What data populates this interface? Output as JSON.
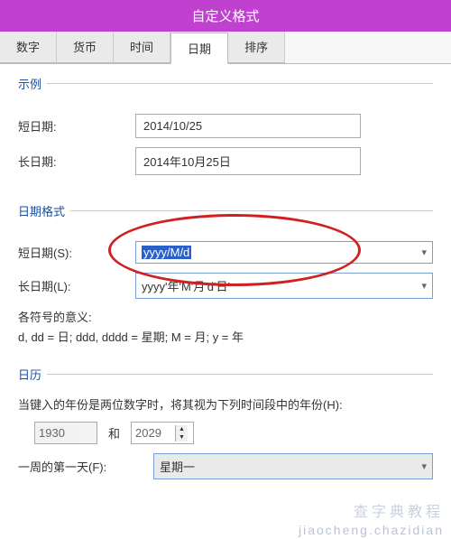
{
  "title": "自定义格式",
  "tabs": {
    "number": "数字",
    "currency": "货币",
    "time": "时间",
    "date": "日期",
    "sort": "排序"
  },
  "example": {
    "legend": "示例",
    "short_label": "短日期:",
    "short_value": "2014/10/25",
    "long_label": "长日期:",
    "long_value": "2014年10月25日"
  },
  "format": {
    "legend": "日期格式",
    "short_label": "短日期(S):",
    "short_value": "yyyy/M/d",
    "long_label": "长日期(L):",
    "long_value": "yyyy'年'M'月'd'日'",
    "meaning_label": "各符号的意义:",
    "meaning_text": "d, dd = 日;  ddd, dddd = 星期;  M = 月;  y = 年"
  },
  "calendar": {
    "legend": "日历",
    "two_digit_label": "当键入的年份是两位数字时，将其视为下列时间段中的年份(H):",
    "year_from": "1930",
    "and": "和",
    "year_to": "2029",
    "first_day_label": "一周的第一天(F):",
    "first_day_value": "星期一"
  },
  "watermark1": "查字典教程",
  "watermark2": "jiaocheng.chazidian"
}
